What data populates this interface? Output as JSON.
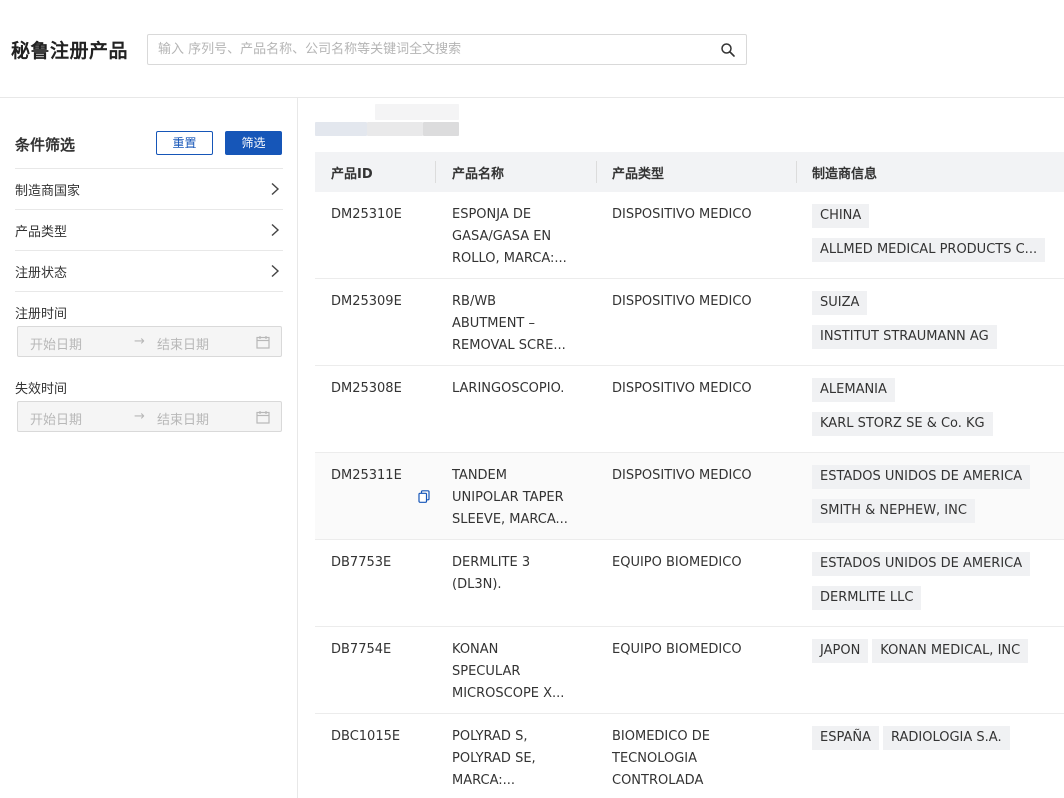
{
  "header": {
    "title": "秘鲁注册产品",
    "search_placeholder": "输入 序列号、产品名称、公司名称等关键词全文搜索"
  },
  "sidebar": {
    "title": "条件筛选",
    "reset_label": "重置",
    "filter_label": "筛选",
    "items": [
      {
        "label": "制造商国家"
      },
      {
        "label": "产品类型"
      },
      {
        "label": "注册状态"
      }
    ],
    "registration_date": {
      "label": "注册时间",
      "start_placeholder": "开始日期",
      "end_placeholder": "结束日期"
    },
    "expiry_date": {
      "label": "失效时间",
      "start_placeholder": "开始日期",
      "end_placeholder": "结束日期"
    }
  },
  "table": {
    "columns": [
      "产品ID",
      "产品名称",
      "产品类型",
      "制造商信息"
    ],
    "rows": [
      {
        "id": "DM25310E",
        "name_lines": [
          "ESPONJA DE",
          "GASA/GASA EN",
          "ROLLO, MARCA:..."
        ],
        "type_lines": [
          "DISPOSITIVO MEDICO"
        ],
        "country": "CHINA",
        "manufacturer": "ALLMED MEDICAL PRODUCTS C..."
      },
      {
        "id": "DM25309E",
        "name_lines": [
          "RB/WB",
          "ABUTMENT –",
          "REMOVAL SCRE..."
        ],
        "type_lines": [
          "DISPOSITIVO MEDICO"
        ],
        "country": "SUIZA",
        "manufacturer": "INSTITUT STRAUMANN AG"
      },
      {
        "id": "DM25308E",
        "name_lines": [
          "LARINGOSCOPIO."
        ],
        "type_lines": [
          "DISPOSITIVO MEDICO"
        ],
        "country": "ALEMANIA",
        "manufacturer": "KARL STORZ SE & Co. KG"
      },
      {
        "id": "DM25311E",
        "name_lines": [
          "TANDEM",
          "UNIPOLAR TAPER",
          "SLEEVE, MARCA..."
        ],
        "type_lines": [
          "DISPOSITIVO MEDICO"
        ],
        "country": "ESTADOS UNIDOS DE AMERICA",
        "manufacturer": "SMITH & NEPHEW, INC"
      },
      {
        "id": "DB7753E",
        "name_lines": [
          "DERMLITE 3",
          "(DL3N)."
        ],
        "type_lines": [
          "EQUIPO BIOMEDICO"
        ],
        "country": "ESTADOS UNIDOS DE AMERICA",
        "manufacturer": "DERMLITE LLC"
      },
      {
        "id": "DB7754E",
        "name_lines": [
          "KONAN",
          "SPECULAR",
          "MICROSCOPE X..."
        ],
        "type_lines": [
          "EQUIPO BIOMEDICO"
        ],
        "country": "JAPON",
        "manufacturer": "KONAN MEDICAL, INC"
      },
      {
        "id": "DBC1015E",
        "name_lines": [
          "POLYRAD S,",
          "POLYRAD SE,",
          "MARCA:..."
        ],
        "type_lines": [
          "BIOMEDICO DE",
          "TECNOLOGIA",
          "CONTROLADA"
        ],
        "country": "ESPAÑA",
        "manufacturer": "RADIOLOGIA S.A."
      }
    ]
  },
  "colors": {
    "primary": "#1656b8",
    "header_bg": "#f2f3f5",
    "tag_bg": "#f0f1f3"
  }
}
